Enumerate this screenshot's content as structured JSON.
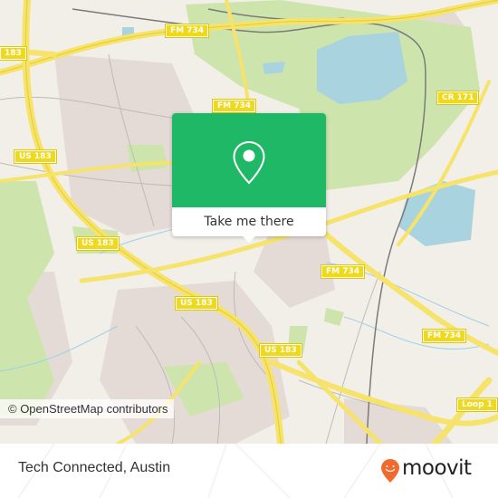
{
  "map": {
    "attribution": "© OpenStreetMap contributors",
    "road_labels": [
      {
        "id": "us183-nw",
        "text": "183"
      },
      {
        "id": "fm734-top",
        "text": "FM 734"
      },
      {
        "id": "fm734-mid",
        "text": "FM 734"
      },
      {
        "id": "cr171",
        "text": "CR 171"
      },
      {
        "id": "us183-left",
        "text": "US 183"
      },
      {
        "id": "us183-mid",
        "text": "US 183"
      },
      {
        "id": "us183-center",
        "text": "US 183"
      },
      {
        "id": "fm734-east",
        "text": "FM 734"
      },
      {
        "id": "fm734-se",
        "text": "FM 734"
      },
      {
        "id": "us183-south",
        "text": "US 183"
      },
      {
        "id": "loop1",
        "text": "Loop 1"
      }
    ],
    "colors": {
      "land": "#f2efe9",
      "park": "#cfe6b0",
      "water": "#aad3df",
      "road": "#f5e36b",
      "residential": "#e6dcd8",
      "rail": "#777777"
    }
  },
  "popup": {
    "icon": "map-pin-icon",
    "action_label": "Take me there",
    "accent_color": "#1fb866"
  },
  "footer": {
    "place_title": "Tech Connected, Austin",
    "brand": {
      "name": "moovit",
      "icon": "moovit-smile-pin-icon",
      "color": "#f26a30"
    }
  }
}
